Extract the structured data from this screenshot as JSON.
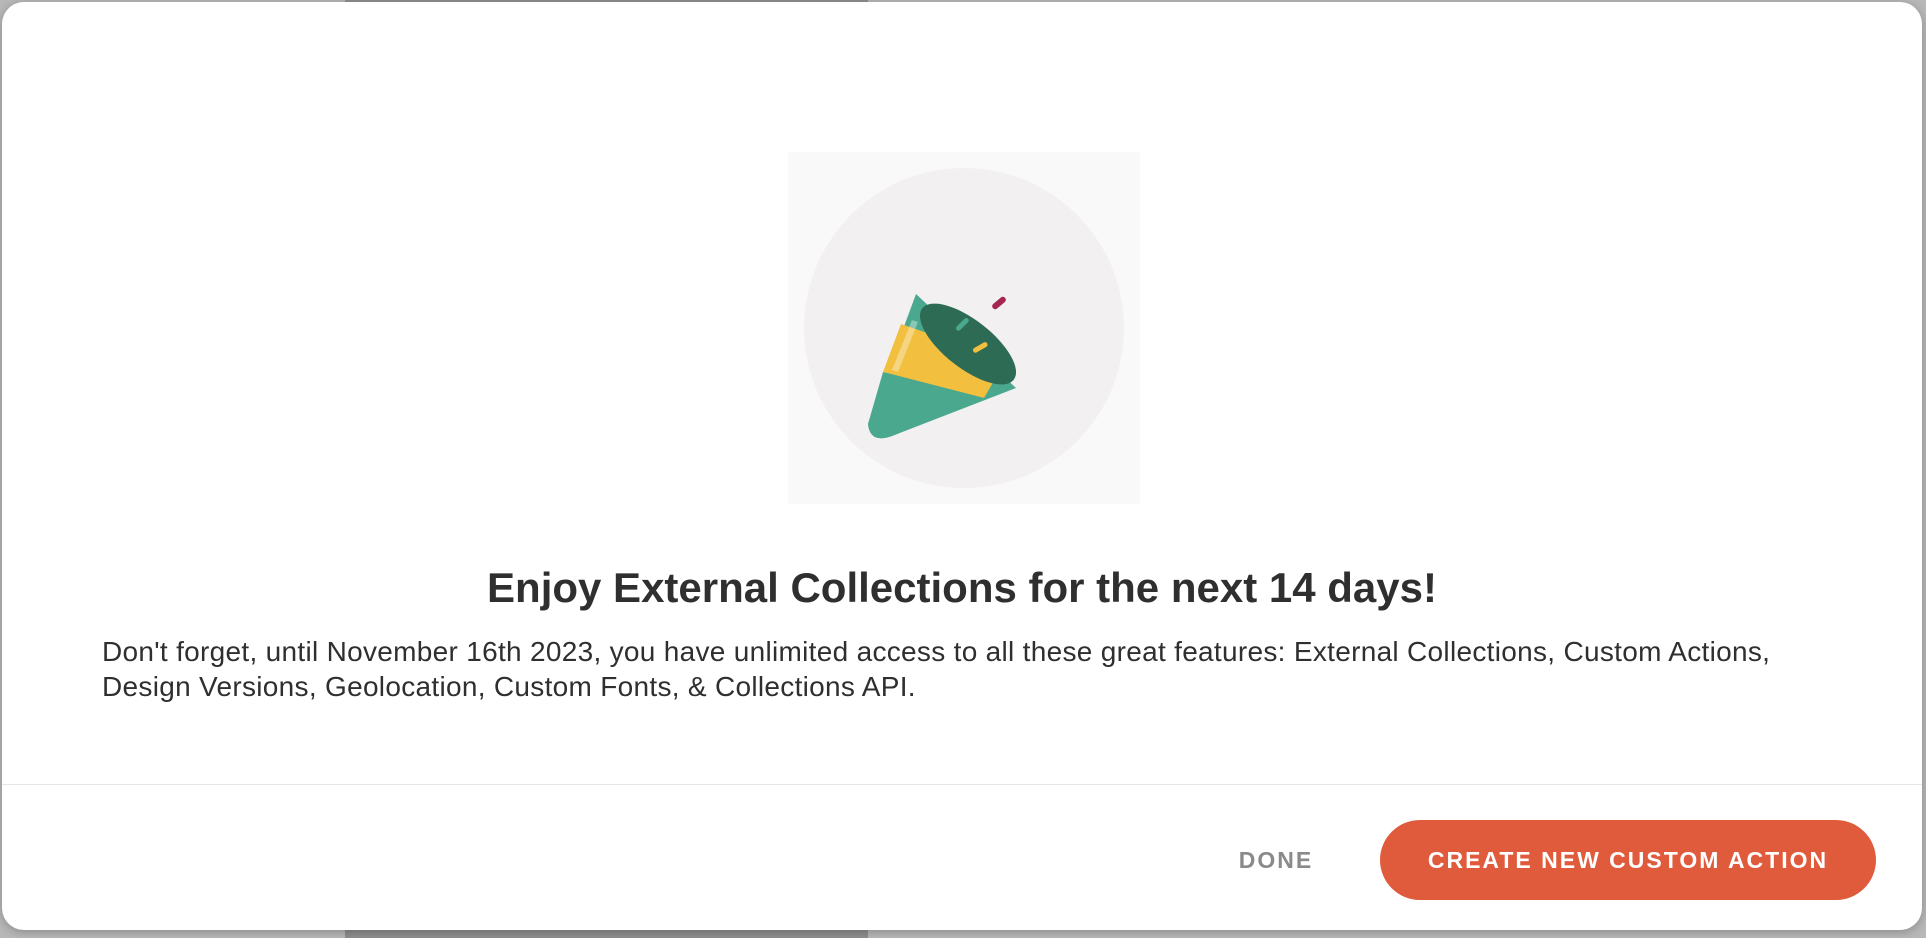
{
  "modal": {
    "illustration": {
      "icon": "party-popper-icon",
      "colors": {
        "circle": "#f3f0f1",
        "cone": "#4aa88e",
        "cone_dark": "#2e6b55",
        "stripe": "#f2bf3e",
        "confetti_red": "#a3264f",
        "confetti_teal": "#4aa88e",
        "confetti_yellow": "#f2bf3e"
      }
    },
    "title": "Enjoy External Collections for the next 14 days!",
    "description": "Don't forget, until November 16th 2023, you have unlimited access to all these great features: External Collections, Custom Actions, Design Versions, Geolocation, Custom Fonts, & Collections API.",
    "footer": {
      "done_label": "DONE",
      "primary_label": "CREATE NEW CUSTOM ACTION",
      "primary_color": "#e05a3c"
    }
  }
}
